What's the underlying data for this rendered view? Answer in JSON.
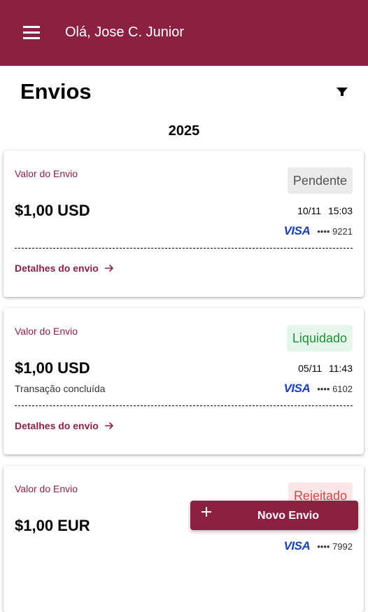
{
  "header": {
    "greeting": "Olá, Jose C. Junior",
    "menu_icon": "hamburger-menu-icon"
  },
  "page": {
    "title": "Envios",
    "filter_icon": "filter-funnel-icon",
    "year": "2025"
  },
  "colors": {
    "brand": "#8b2142",
    "status_pending_bg": "#ebebeb",
    "status_pending_text": "#555555",
    "status_settled_bg": "#e7f6ea",
    "status_settled_text": "#1f8f3a",
    "status_rejected_bg": "#fbe7e7",
    "status_rejected_text": "#d04848",
    "visa": "#1a3fb8"
  },
  "cards": [
    {
      "label": "Valor do Envio",
      "amount": "$1,00 USD",
      "subtitle": "",
      "status": "Pendente",
      "date": "10/11",
      "time": "15:03",
      "card_brand": "VISA",
      "card_mask": "•••• 9221",
      "details_label": "Detalhes do envio"
    },
    {
      "label": "Valor do Envio",
      "amount": "$1,00 USD",
      "subtitle": "Transação concluída",
      "status": "Liquidado",
      "date": "05/11",
      "time": "11:43",
      "card_brand": "VISA",
      "card_mask": "•••• 6102",
      "details_label": "Detalhes do envio"
    },
    {
      "label": "Valor do Envio",
      "amount": "$1,00 EUR",
      "subtitle": "",
      "status": "Rejeitado",
      "card_brand": "VISA",
      "card_mask": "•••• 7992"
    }
  ],
  "fab": {
    "label": "Novo Envio",
    "icon": "plus-icon"
  }
}
